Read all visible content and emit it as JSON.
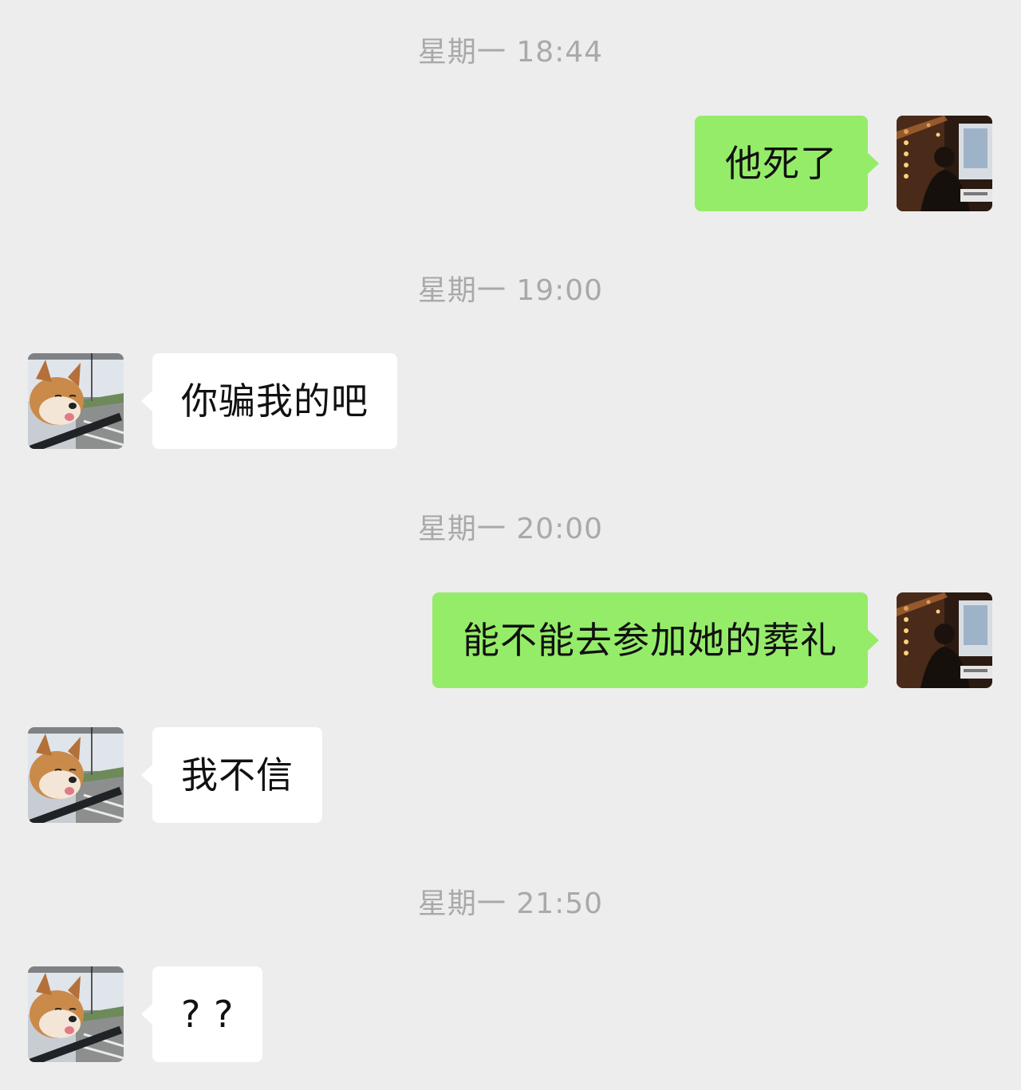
{
  "chat": {
    "messages": [
      {
        "type": "time",
        "text": "星期一 18:44"
      },
      {
        "type": "message",
        "side": "sent",
        "text": "他死了",
        "avatar": "self-avatar"
      },
      {
        "type": "time",
        "text": "星期一 19:00"
      },
      {
        "type": "message",
        "side": "received",
        "text": "你骗我的吧",
        "avatar": "dog-avatar"
      },
      {
        "type": "time",
        "text": "星期一 20:00"
      },
      {
        "type": "message",
        "side": "sent",
        "text": "能不能去参加她的葬礼",
        "avatar": "self-avatar"
      },
      {
        "type": "message",
        "side": "received",
        "text": "我不信",
        "avatar": "dog-avatar"
      },
      {
        "type": "time",
        "text": "星期一 21:50"
      },
      {
        "type": "message",
        "side": "received",
        "text": "? ?",
        "avatar": "dog-avatar"
      }
    ]
  },
  "colors": {
    "background": "#ededed",
    "sent_bubble": "#95ec69",
    "received_bubble": "#ffffff",
    "timestamp_text": "#a9a9a9"
  }
}
